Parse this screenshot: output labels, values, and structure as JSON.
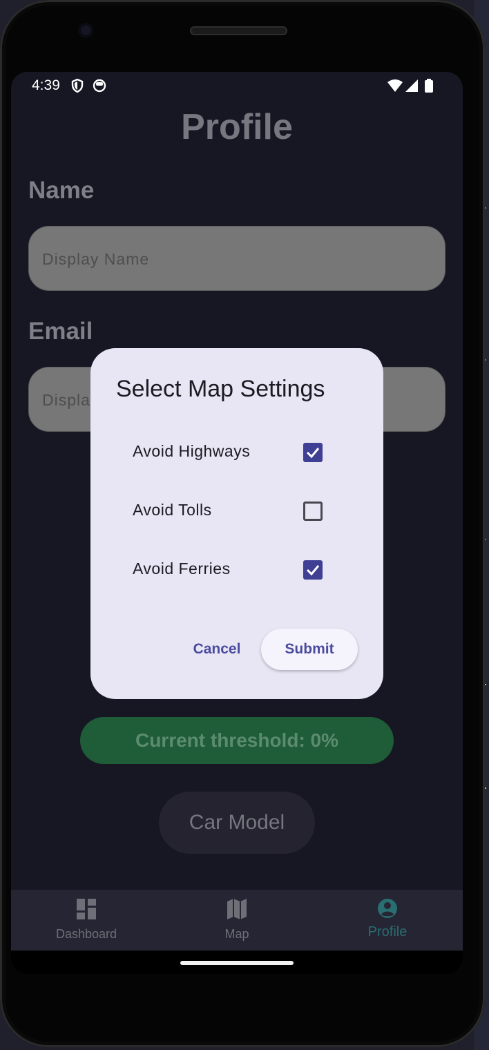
{
  "status_bar": {
    "time": "4:39",
    "icons": [
      "shield-icon",
      "face-icon",
      "wifi-icon",
      "signal-icon",
      "battery-icon"
    ]
  },
  "profile": {
    "title": "Profile",
    "name_label": "Name",
    "name_placeholder": "Display Name",
    "email_label": "Email",
    "email_placeholder": "Displa",
    "threshold_text": "Current threshold: 0%",
    "car_model_label": "Car Model"
  },
  "dialog": {
    "title": "Select Map Settings",
    "options": [
      {
        "label": "Avoid Highways",
        "checked": true
      },
      {
        "label": "Avoid Tolls",
        "checked": false
      },
      {
        "label": "Avoid Ferries",
        "checked": true
      }
    ],
    "cancel_label": "Cancel",
    "submit_label": "Submit"
  },
  "bottom_nav": {
    "items": [
      {
        "label": "Dashboard",
        "icon": "dashboard-icon",
        "active": false
      },
      {
        "label": "Map",
        "icon": "map-icon",
        "active": false
      },
      {
        "label": "Profile",
        "icon": "account-circle-icon",
        "active": true
      }
    ]
  },
  "colors": {
    "screen_bg": "#171724",
    "dialog_bg": "#e8e6f4",
    "accent": "#3f3f93",
    "threshold_bg": "#1f5c38",
    "nav_active": "#2a6e72"
  }
}
